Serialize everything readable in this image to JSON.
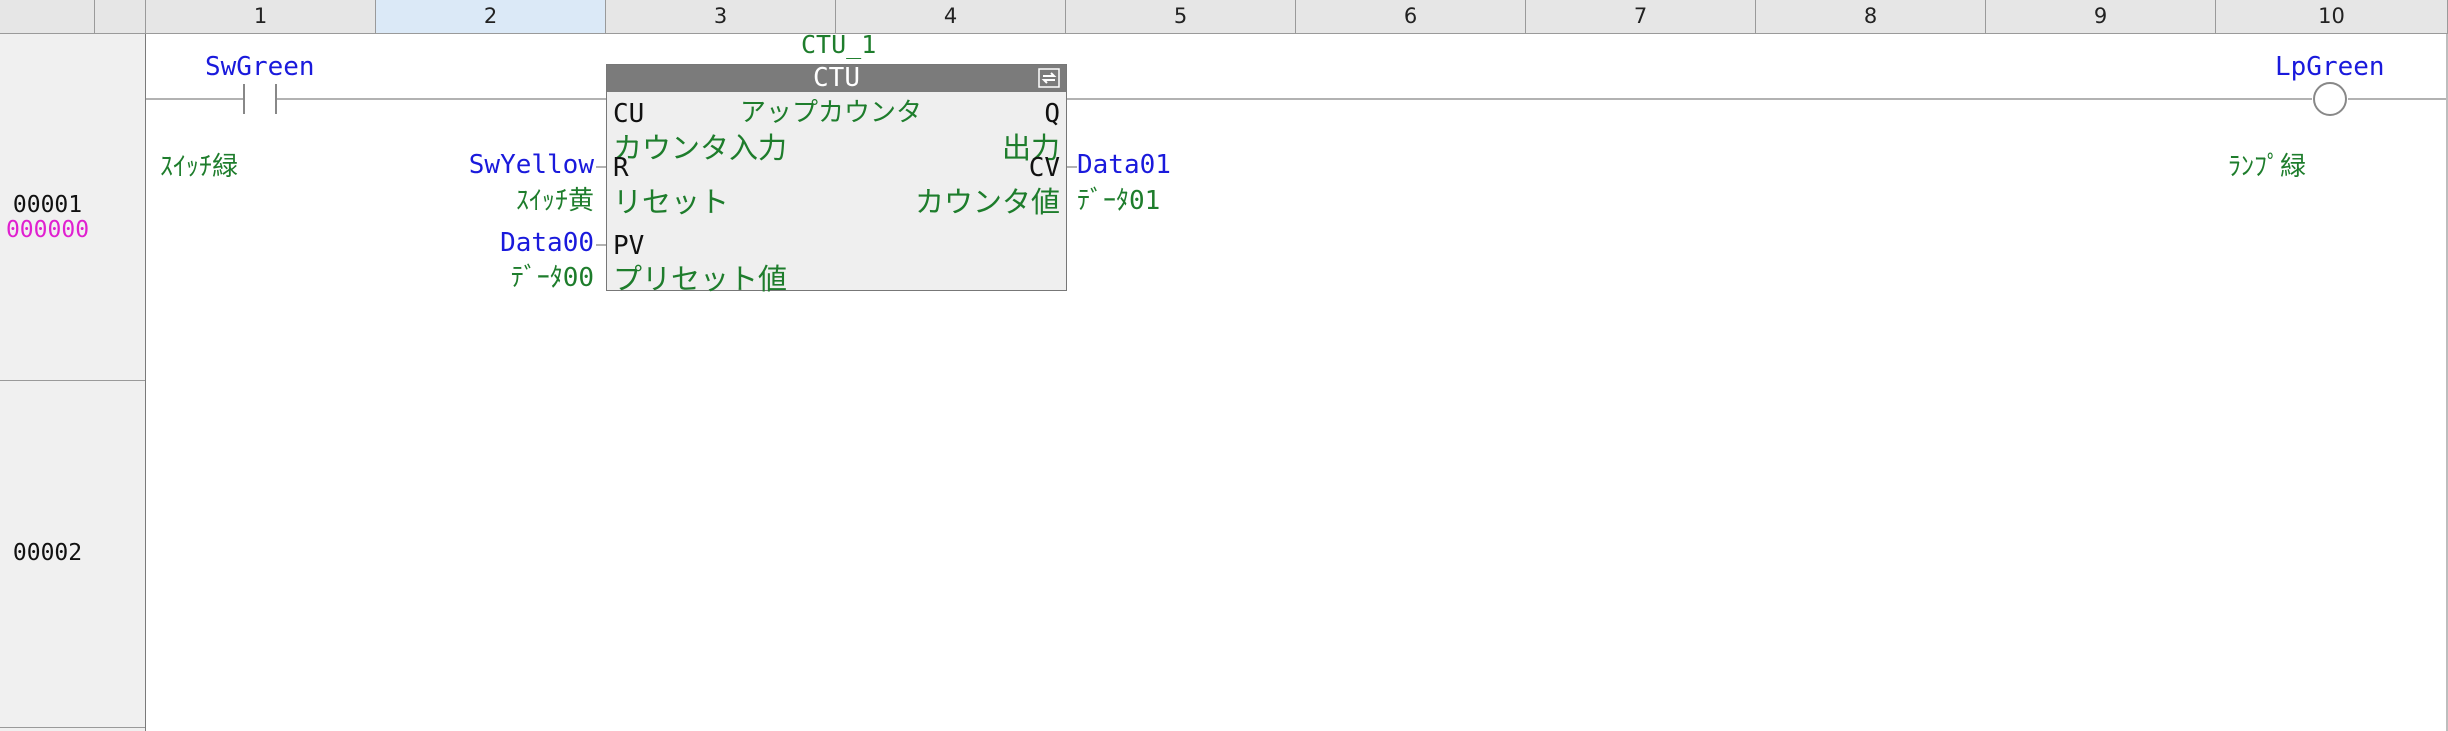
{
  "columns": [
    "1",
    "2",
    "3",
    "4",
    "5",
    "6",
    "7",
    "8",
    "9",
    "10"
  ],
  "selected_column": "2",
  "rungs": [
    {
      "number": "00001",
      "step": "000000"
    },
    {
      "number": "00002",
      "step": ""
    }
  ],
  "contact": {
    "name": "SwGreen",
    "comment": "ｽｲｯﾁ緑"
  },
  "coil": {
    "name": "LpGreen",
    "comment": "ﾗﾝﾌﾟ緑"
  },
  "function_block": {
    "instance": "CTU_1",
    "type": "CTU",
    "comment": "アップカウンタ",
    "inputs": [
      {
        "pin": "CU",
        "desc": "カウンタ入力"
      },
      {
        "pin": "R",
        "desc": "リセット",
        "var": "SwYellow",
        "var_comment": "ｽｲｯﾁ黄"
      },
      {
        "pin": "PV",
        "desc": "プリセット値",
        "var": "Data00",
        "var_comment": "ﾃﾞｰﾀ00"
      }
    ],
    "outputs": [
      {
        "pin": "Q",
        "desc": "出力"
      },
      {
        "pin": "CV",
        "desc": "カウンタ値",
        "var": "Data01",
        "var_comment": "ﾃﾞｰﾀ01"
      }
    ]
  },
  "colors": {
    "variable": "#1a1adc",
    "comment": "#1e7d2c",
    "step": "#e020d0",
    "block_header": "#7b7b7b"
  }
}
